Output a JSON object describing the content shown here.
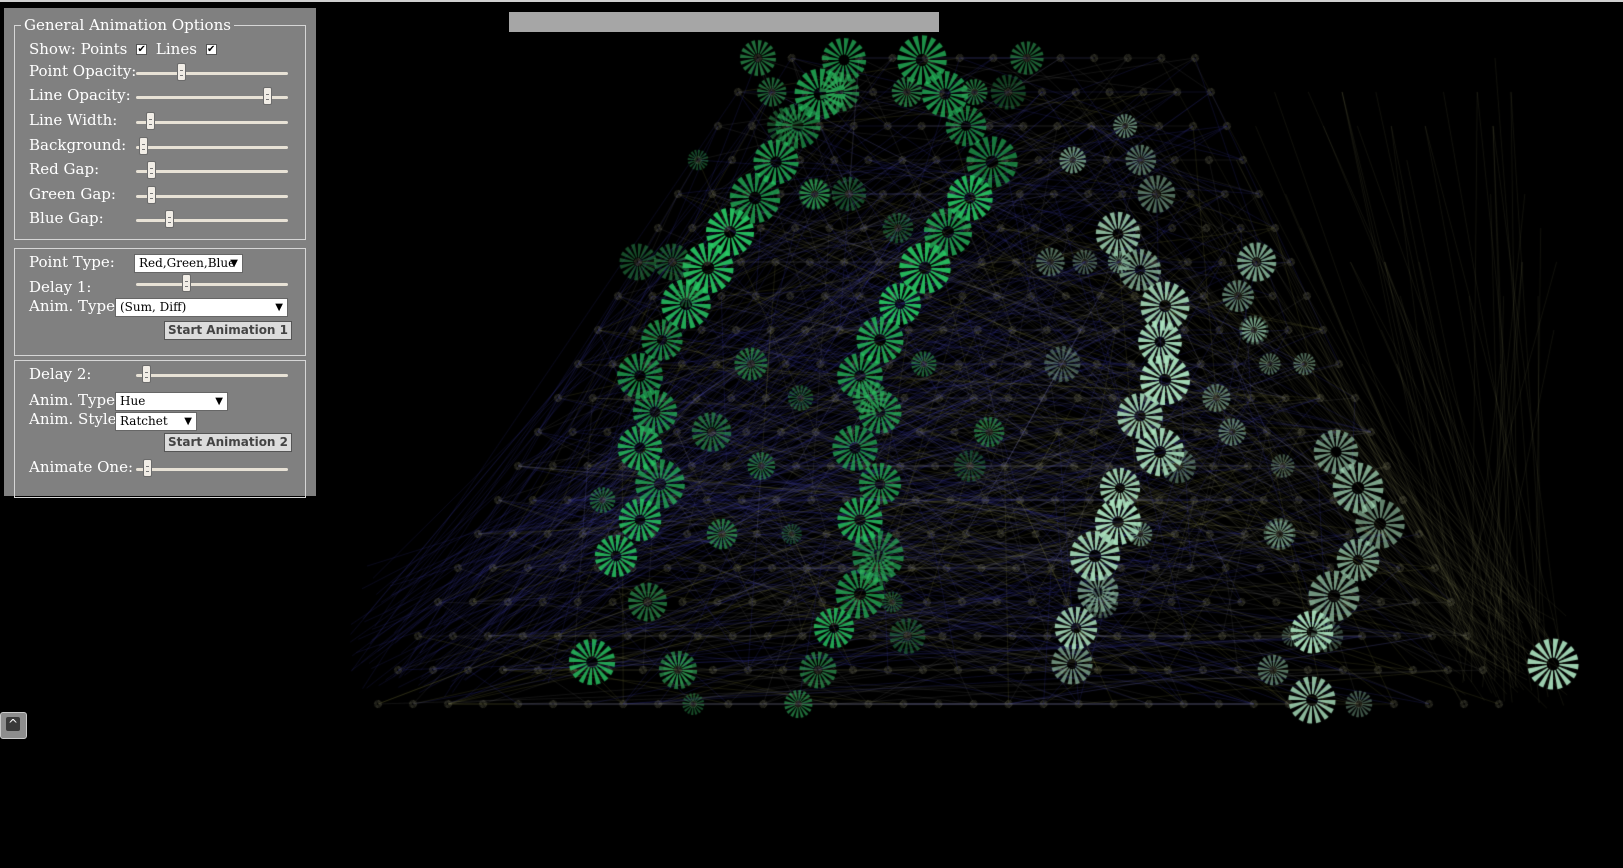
{
  "panel": {
    "title": "General Animation Options",
    "show_label": "Show:",
    "points_label": "Points",
    "points_checked": true,
    "lines_label": "Lines",
    "lines_checked": true,
    "sliders": [
      {
        "label": "Point Opacity:",
        "value": 0.29
      },
      {
        "label": "Line Opacity:",
        "value": 0.89
      },
      {
        "label": "Line Width:",
        "value": 0.07
      },
      {
        "label": "Background:",
        "value": 0.02
      },
      {
        "label": "Red Gap:",
        "value": 0.08
      },
      {
        "label": "Green Gap:",
        "value": 0.08
      },
      {
        "label": "Blue Gap:",
        "value": 0.2
      }
    ],
    "point_type_label": "Point Type:",
    "point_type_value": "Red,Green,Blue",
    "delay1_label": "Delay 1:",
    "delay1_value": 0.32,
    "anim_type1_label": "Anim. Type:",
    "anim_type1_value": "(Sum, Diff)",
    "start1_label": "Start Animation 1",
    "delay2_label": "Delay 2:",
    "delay2_value": 0.04,
    "anim_type2_label": "Anim. Type:",
    "anim_type2_value": "Hue",
    "anim_style_label": "Anim. Style:",
    "anim_style_value": "Ratchet",
    "start2_label": "Start Animation 2",
    "animate_one_label": "Animate One:",
    "animate_one_value": 0.05
  },
  "icons": {
    "dropdown": "triangle-down-icon",
    "corner": "caret-up-icon"
  },
  "colors": {
    "background": "#000000",
    "panel": "#808080",
    "point_green": "#2ecc71",
    "point_pale": "#b8e6cc",
    "line_blue": "#3a3aa8",
    "line_olive": "#8a8a3a",
    "line_grey": "#8a8a8a"
  }
}
